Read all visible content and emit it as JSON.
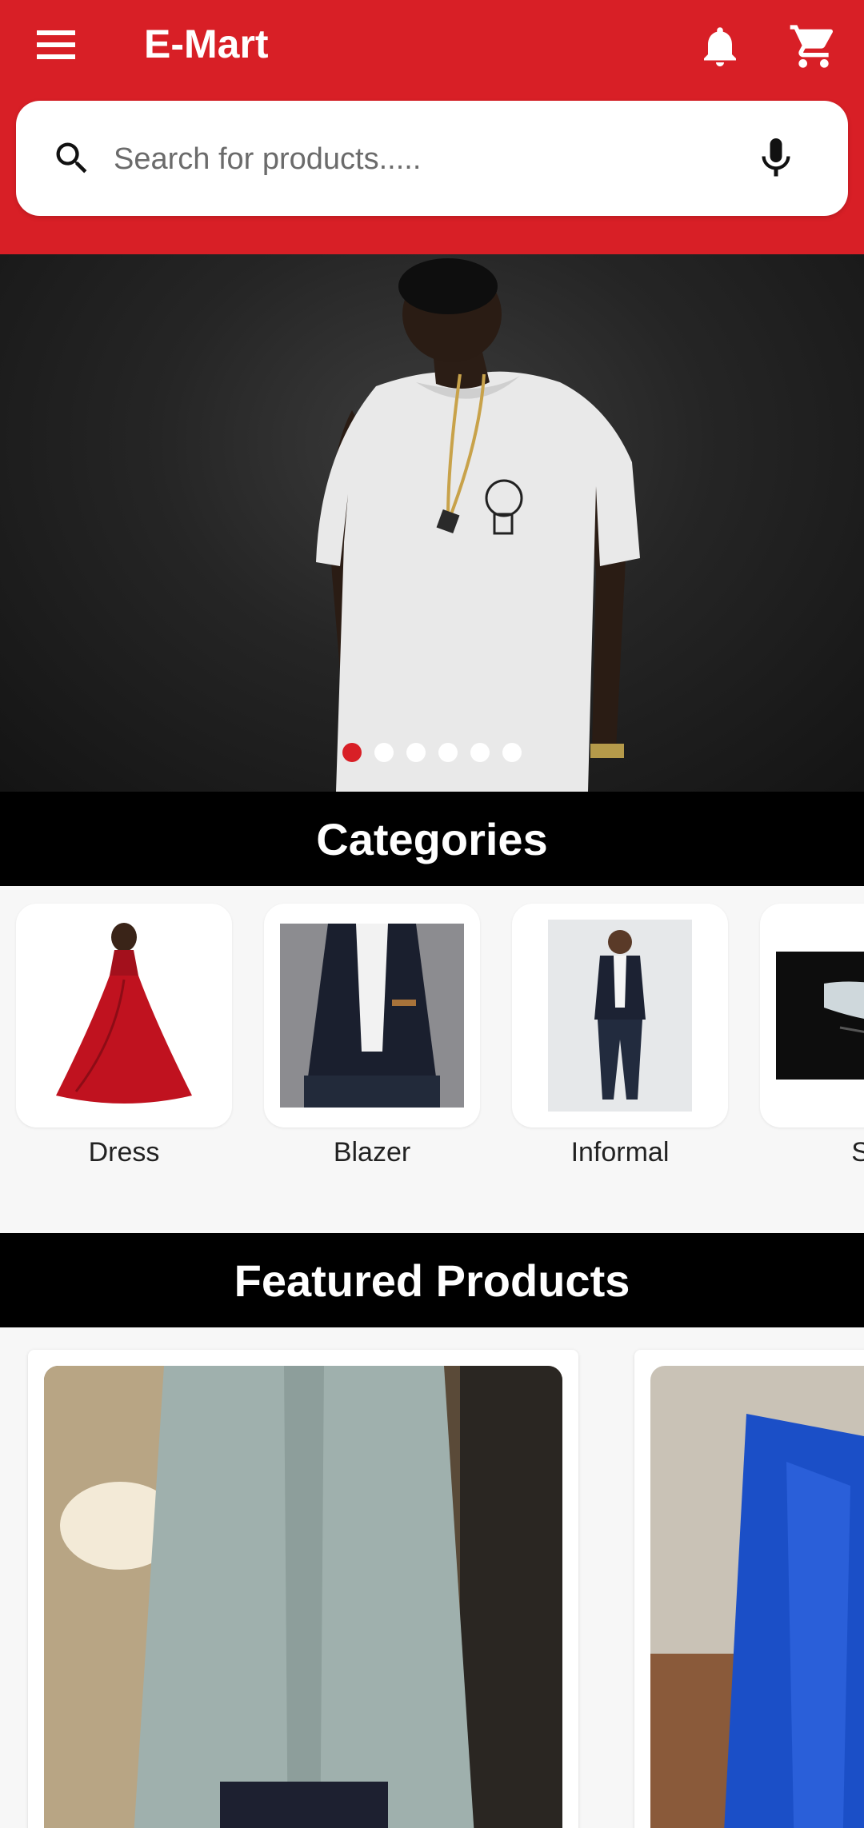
{
  "header": {
    "title": "E-Mart",
    "menu_icon": "menu-icon",
    "notification_icon": "bell-icon",
    "cart_icon": "cart-icon",
    "background": "#d81f26"
  },
  "search": {
    "placeholder": "Search for products.....",
    "search_icon": "search-icon",
    "voice_icon": "mic-icon"
  },
  "banner": {
    "image": "man in white t-shirt with bulb print",
    "slide_count": 6,
    "active_slide": 1
  },
  "categories": {
    "title": "Categories",
    "items": [
      {
        "label": "Dress",
        "image": "red gown"
      },
      {
        "label": "Blazer",
        "image": "black blazer"
      },
      {
        "label": "Informal",
        "image": "man in casual outfit"
      },
      {
        "label": "Sh",
        "image": "shoes"
      }
    ]
  },
  "featured": {
    "title": "Featured Products",
    "items": [
      {
        "image": "grey formal shirt"
      },
      {
        "image": "blue patterned blazer"
      }
    ]
  }
}
